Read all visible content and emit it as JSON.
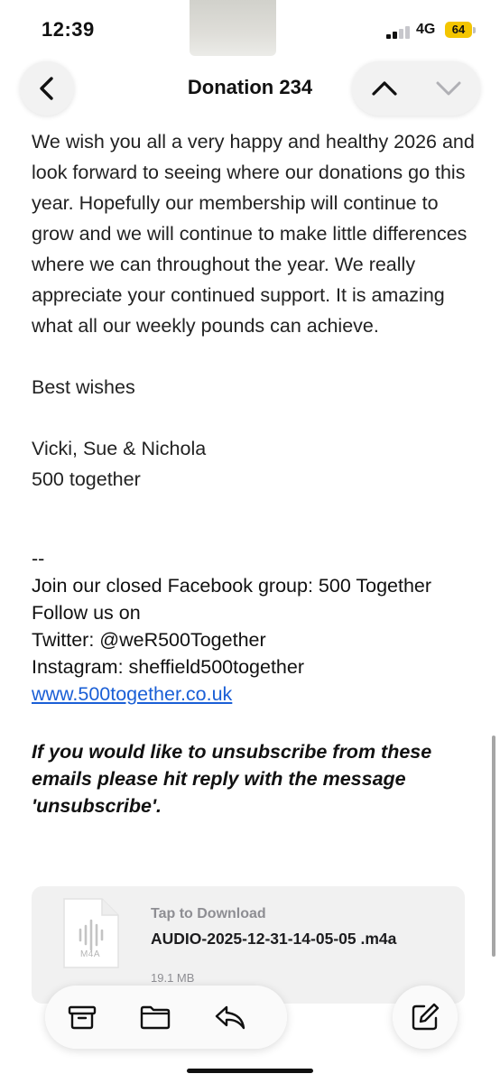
{
  "status_bar": {
    "time": "12:39",
    "network": "4G",
    "battery": "64",
    "battery_color": "#f3c500"
  },
  "nav": {
    "back_icon": "chevron-left-icon",
    "title": "Donation 234",
    "prev_icon": "chevron-up-icon",
    "next_icon": "chevron-down-icon"
  },
  "body": {
    "paragraph": "We wish you all a very happy and healthy 2026 and look forward to seeing where our donations go this year.  Hopefully our membership will continue to grow and we will continue to make little differences where we can throughout the year.   We really appreciate your continued support.  It is amazing what all our weekly pounds can achieve.",
    "closing": "Best wishes",
    "signature_names": "Vicki, Sue & Nichola",
    "signature_org": "500 together",
    "separator": "--",
    "facebook_line": "Join our closed Facebook group: 500 Together",
    "follow_line": "Follow us on",
    "twitter_line": "Twitter: @weR500Together",
    "instagram_line": "Instagram: sheffield500together",
    "website_link": "www.500together.co.uk",
    "unsubscribe_note": "If you would like to unsubscribe from these emails please hit reply with the message 'unsubscribe'.",
    "link_color": "#1a5fd6"
  },
  "attachment": {
    "action": "Tap to Download",
    "file_name": "AUDIO-2025-12-31-14-05-05 .m4a",
    "file_size": "19.1 MB",
    "file_type": "M4A",
    "icon": "audio-file-icon"
  },
  "toolbar": {
    "archive_icon": "archive-icon",
    "move_icon": "folder-icon",
    "reply_icon": "reply-icon",
    "compose_icon": "compose-icon"
  }
}
